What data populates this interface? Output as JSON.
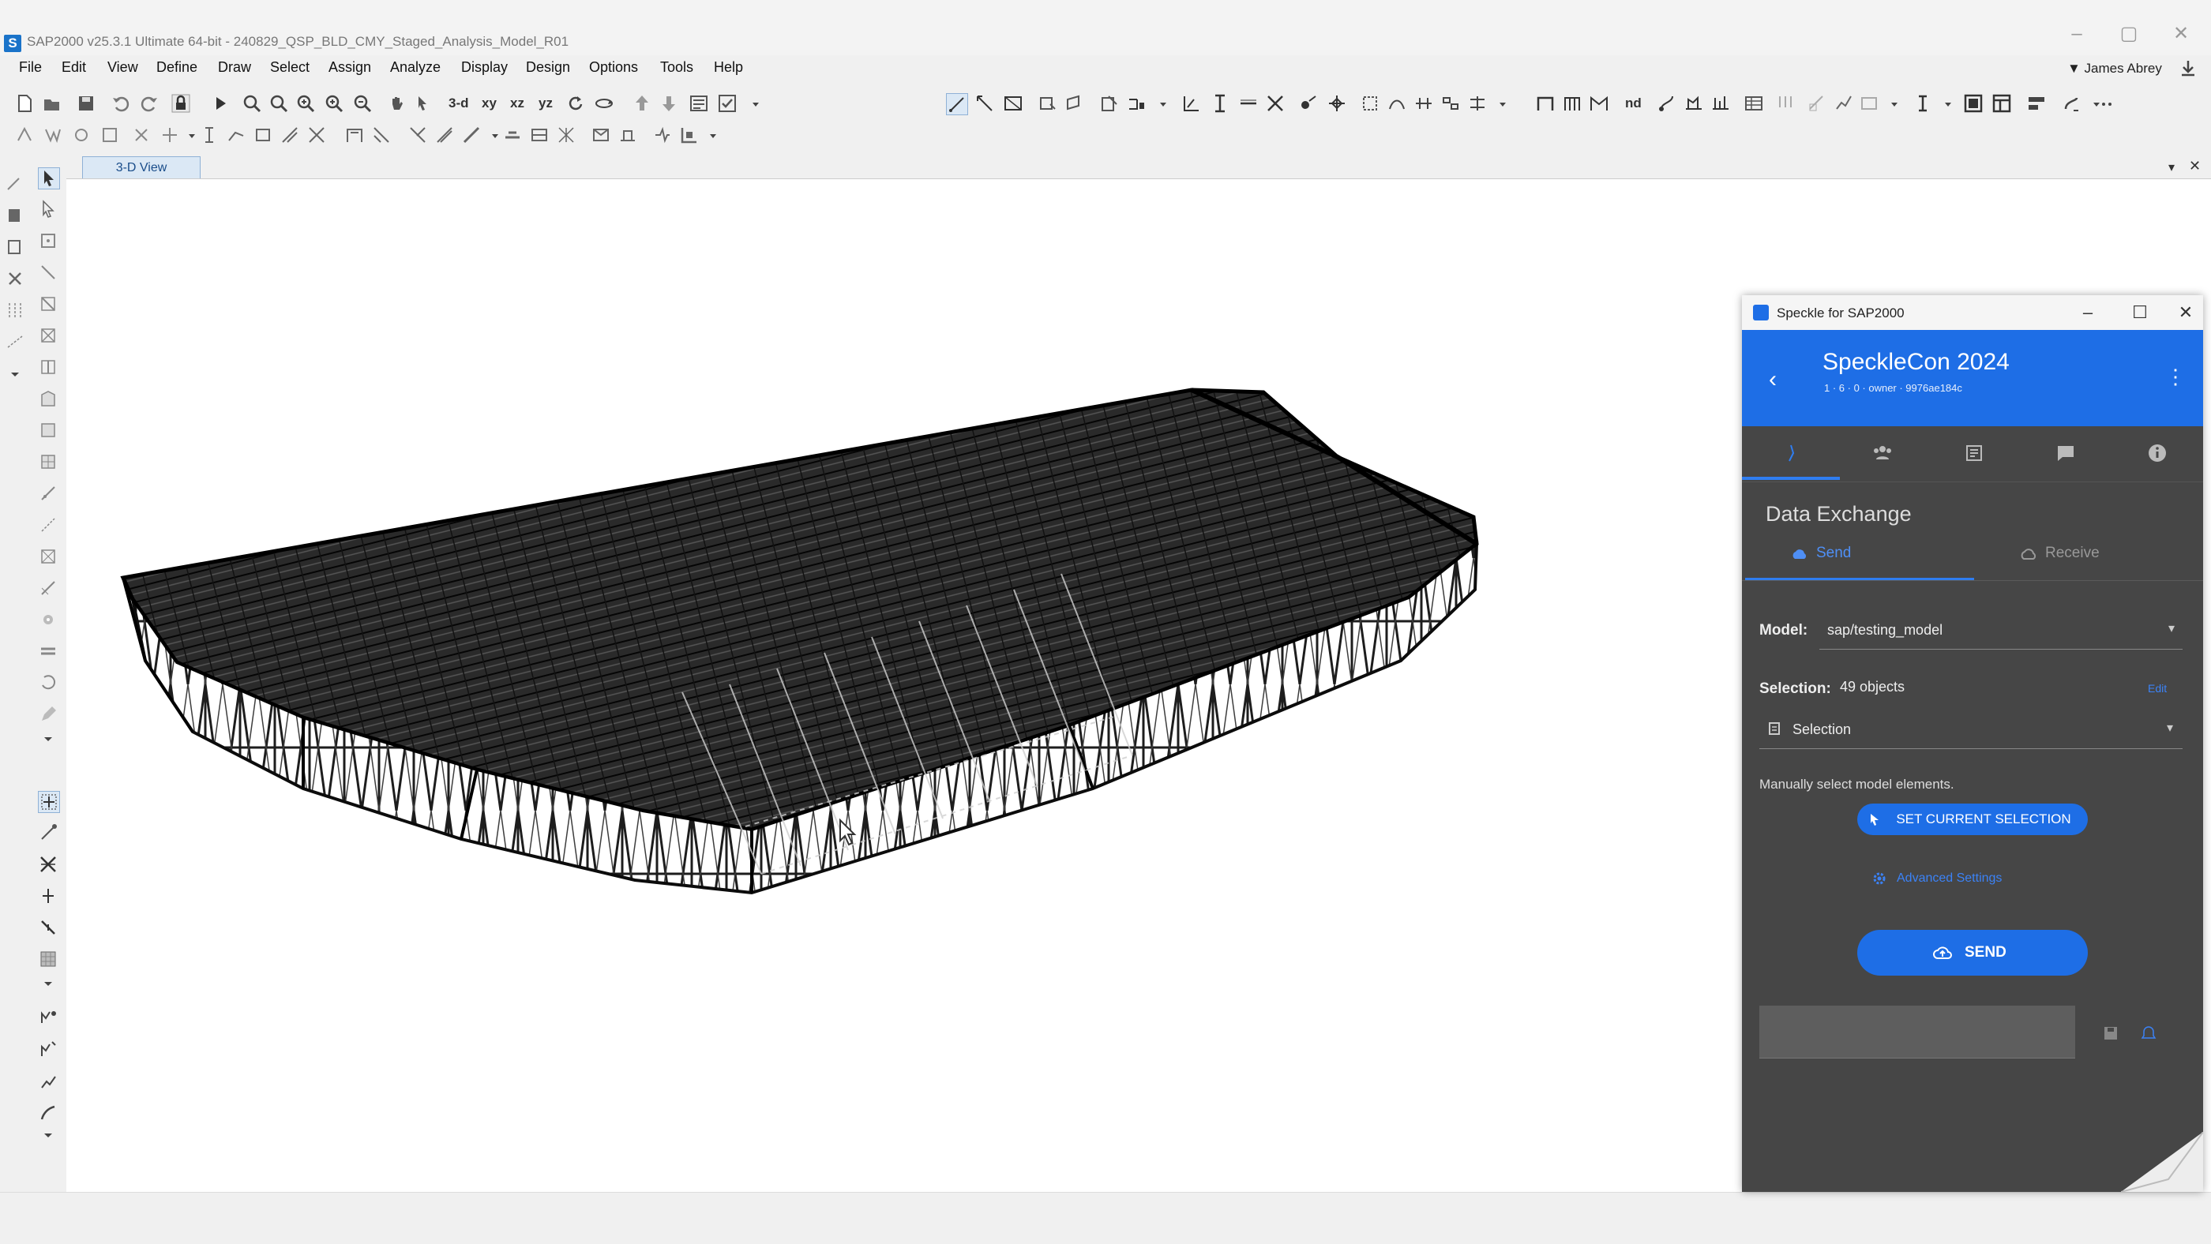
{
  "window": {
    "title": "SAP2000 v25.3.1 Ultimate 64-bit - 240829_QSP_BLD_CMY_Staged_Analysis_Model_R01",
    "app_icon_letter": "S",
    "minimize": "–",
    "maximize": "▢",
    "close": "✕"
  },
  "menu": [
    "File",
    "Edit",
    "View",
    "Define",
    "Draw",
    "Select",
    "Assign",
    "Analyze",
    "Display",
    "Design",
    "Options",
    "Tools",
    "Help"
  ],
  "user": "▼ James Abrey",
  "toolbar_text": {
    "view_3d": "3-d",
    "view_xy": "xy",
    "view_xz": "xz",
    "view_yz": "yz",
    "nd": "nd"
  },
  "view_tab": "3-D View",
  "view_controls": {
    "dropdown": "▾",
    "close": "✕"
  },
  "speckle": {
    "window_title": "Speckle for SAP2000",
    "win_minimize": "–",
    "win_maximize": "☐",
    "win_close": "✕",
    "back": "‹",
    "project_name": "SpeckleCon 2024",
    "project_meta": "1 · 6 · 0 · owner · 9976ae184c",
    "more": "⋮",
    "tabs": [
      "send-icon",
      "team-icon",
      "model-icon",
      "comments-icon",
      "info-icon"
    ],
    "section_title": "Data Exchange",
    "subtab_send": "Send",
    "subtab_receive": "Receive",
    "model_label": "Model:",
    "model_value": "sap/testing_model",
    "selection_label": "Selection:",
    "selection_count": "49 objects",
    "selection_edit": "Edit",
    "filter_value": "Selection",
    "hint": "Manually select model elements.",
    "set_selection_button": "SET CURRENT SELECTION",
    "advanced_settings": "Advanced Settings",
    "send_button": "SEND",
    "colors": {
      "accent": "#1e6ee6",
      "panel": "#464646",
      "link": "#3b82f6"
    }
  }
}
